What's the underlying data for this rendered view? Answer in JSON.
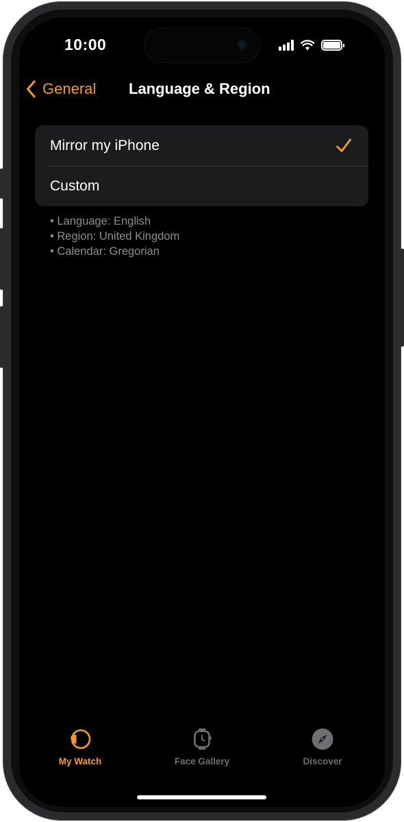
{
  "status_bar": {
    "time": "10:00",
    "battery_icon": "battery-full-icon",
    "signal_icon": "cellular-signal-icon",
    "wifi_icon": "wifi-icon"
  },
  "nav": {
    "back_label": "General",
    "back_icon": "chevron-left-icon",
    "title": "Language & Region"
  },
  "options": [
    {
      "label": "Mirror my iPhone",
      "selected": true,
      "icon": "checkmark-icon"
    },
    {
      "label": "Custom",
      "selected": false
    }
  ],
  "info": [
    "Language: English",
    "Region: United Kingdom",
    "Calendar: Gregorian"
  ],
  "tabs": [
    {
      "label": "My Watch",
      "icon": "watch-icon",
      "active": true
    },
    {
      "label": "Face Gallery",
      "icon": "watch-face-icon",
      "active": false
    },
    {
      "label": "Discover",
      "icon": "compass-icon",
      "active": false
    }
  ],
  "colors": {
    "accent": "#f39c25",
    "background": "#000000",
    "group_background": "#1c1c1e",
    "secondary_text": "#8e8e93",
    "inactive_tab": "#6e6e73"
  }
}
